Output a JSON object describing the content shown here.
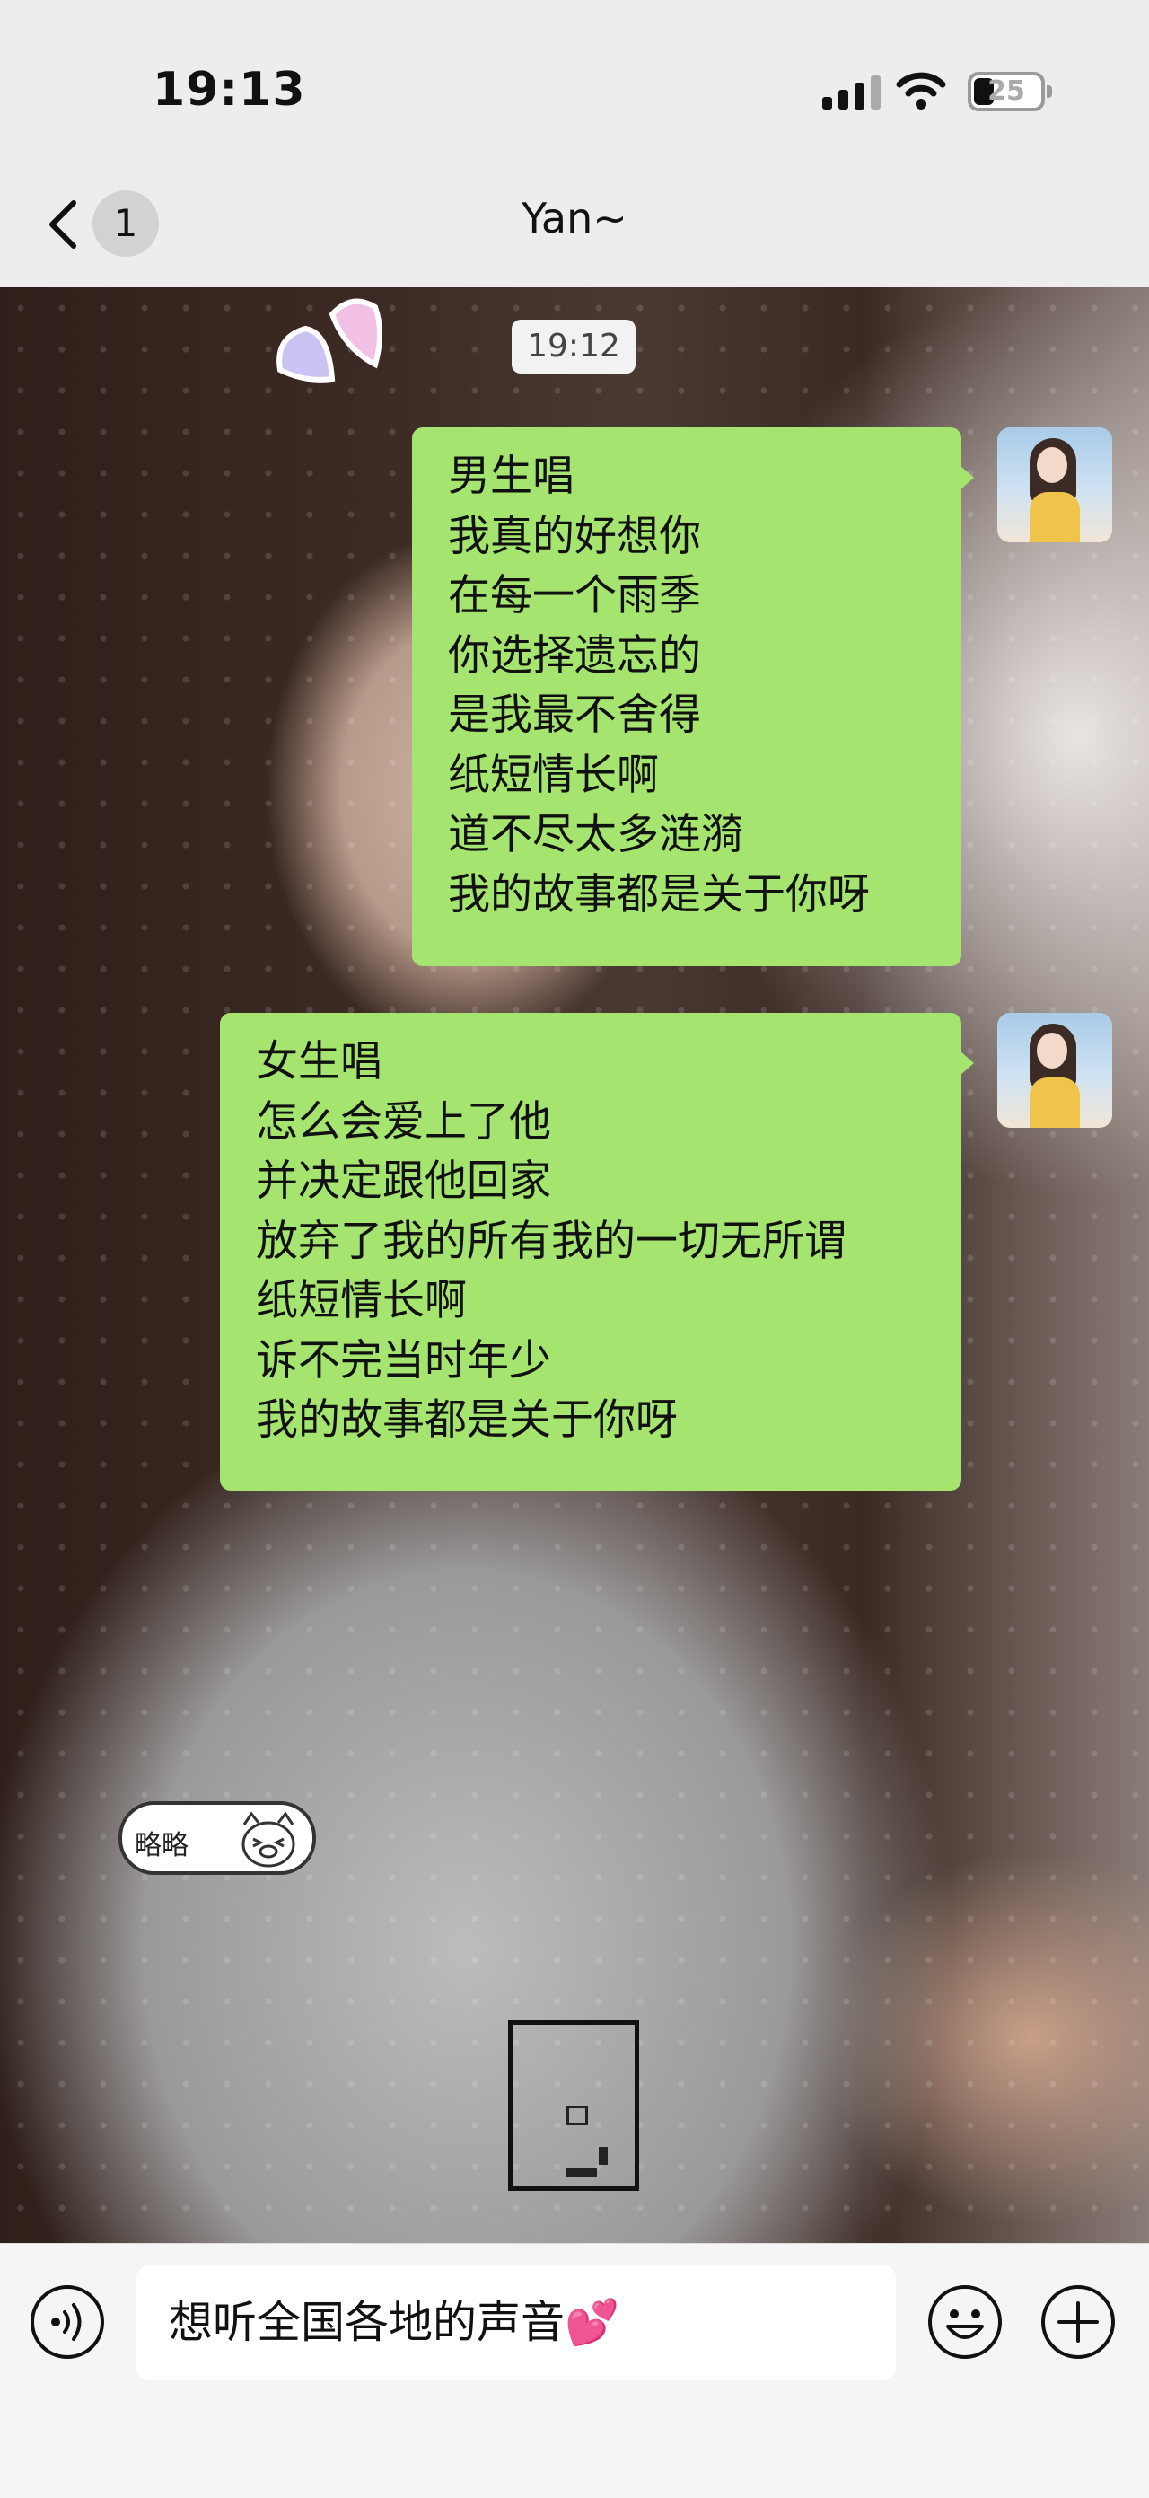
{
  "status": {
    "time": "19:13",
    "battery": "25"
  },
  "nav": {
    "unread": "1",
    "title": "Yan~"
  },
  "chat": {
    "timestamp": "19:12",
    "messages": [
      {
        "lines": [
          "男生唱",
          "我真的好想你",
          "在每一个雨季",
          "你选择遗忘的",
          "是我最不舍得",
          "纸短情长啊",
          "道不尽太多涟漪",
          "我的故事都是关于你呀"
        ]
      },
      {
        "lines": [
          "女生唱",
          "怎么会爱上了他",
          "并决定跟他回家",
          "放弃了我的所有我的一切无所谓",
          "纸短情长啊",
          "诉不完当时年少",
          "我的故事都是关于你呀"
        ]
      }
    ],
    "sticker_text": "略略"
  },
  "input": {
    "value": "想听全国各地的声音💕"
  },
  "colors": {
    "bubble": "#a5e46f",
    "bar": "#f5f5f5",
    "nav": "#ededed"
  },
  "icons": [
    "back-chevron-icon",
    "more-icon",
    "voice-icon",
    "emoji-icon",
    "plus-icon"
  ]
}
